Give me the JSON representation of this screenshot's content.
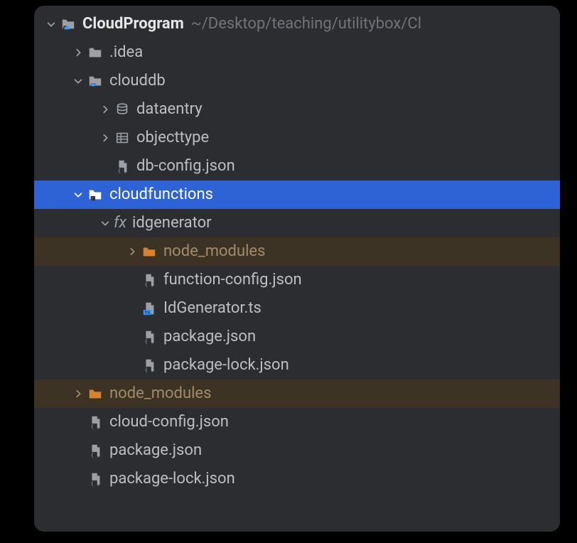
{
  "rootPathHint": "~/Desktop/teaching/utilitybox/Cl",
  "tree": [
    {
      "depth": 0,
      "expand": "open",
      "icon": "folder-cloud",
      "label": "CloudProgram",
      "bold": true,
      "pathHint": true
    },
    {
      "depth": 1,
      "expand": "closed",
      "icon": "folder",
      "label": ".idea"
    },
    {
      "depth": 1,
      "expand": "open",
      "icon": "folder-db",
      "label": "clouddb"
    },
    {
      "depth": 2,
      "expand": "closed",
      "icon": "database",
      "label": "dataentry"
    },
    {
      "depth": 2,
      "expand": "closed",
      "icon": "table",
      "label": "objecttype"
    },
    {
      "depth": 2,
      "expand": "none",
      "icon": "json",
      "label": "db-config.json"
    },
    {
      "depth": 1,
      "expand": "open",
      "icon": "folder-fn",
      "label": "cloudfunctions",
      "selected": true
    },
    {
      "depth": 2,
      "expand": "open",
      "icon": "fx",
      "label": "idgenerator",
      "fxPrefix": "fx"
    },
    {
      "depth": 3,
      "expand": "closed",
      "icon": "folder-excluded",
      "label": "node_modules",
      "excluded": true
    },
    {
      "depth": 3,
      "expand": "none",
      "icon": "json",
      "label": "function-config.json"
    },
    {
      "depth": 3,
      "expand": "none",
      "icon": "ts",
      "label": "IdGenerator.ts"
    },
    {
      "depth": 3,
      "expand": "none",
      "icon": "json",
      "label": "package.json"
    },
    {
      "depth": 3,
      "expand": "none",
      "icon": "json",
      "label": "package-lock.json"
    },
    {
      "depth": 1,
      "expand": "closed",
      "icon": "folder-excluded",
      "label": "node_modules",
      "excluded": true
    },
    {
      "depth": 1,
      "expand": "none",
      "icon": "json",
      "label": "cloud-config.json"
    },
    {
      "depth": 1,
      "expand": "none",
      "icon": "json",
      "label": "package.json"
    },
    {
      "depth": 1,
      "expand": "none",
      "icon": "json",
      "label": "package-lock.json"
    }
  ],
  "indentUnit": 38,
  "baseIndent": 14
}
